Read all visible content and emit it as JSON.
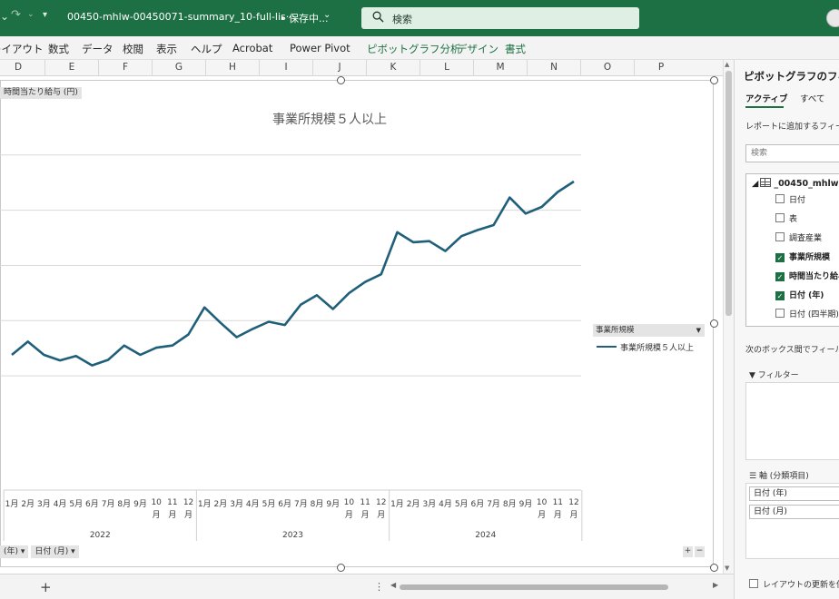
{
  "titlebar": {
    "filename": "00450-mhlw-00450071-summary_10-full-lis···",
    "save_status": "• 保存中...",
    "search_label": "検索",
    "qat_glyph": "▾",
    "chevron_glyph": "⌄"
  },
  "ribbon": {
    "tabs": [
      {
        "label": "レイアウト"
      },
      {
        "label": "数式"
      },
      {
        "label": "データ"
      },
      {
        "label": "校閲"
      },
      {
        "label": "表示"
      },
      {
        "label": "ヘルプ"
      },
      {
        "label": "Acrobat"
      },
      {
        "label": "Power Pivot"
      },
      {
        "label": "ピボットグラフ分析"
      },
      {
        "label": "デザイン"
      },
      {
        "label": "書式"
      }
    ],
    "accent_color": "#1d7044"
  },
  "columns": [
    "D",
    "E",
    "F",
    "G",
    "H",
    "I",
    "J",
    "K",
    "L",
    "M",
    "N",
    "O",
    "P"
  ],
  "chart": {
    "value_field_button": "時間当たり給与 (円)",
    "legend_field_button": "事業所規模",
    "axis_field_buttons": [
      "(年) ▾",
      "日付 (月) ▾"
    ],
    "zoom_in": "+",
    "zoom_out": "−"
  },
  "chart_data": {
    "type": "line",
    "title": "事業所規模５人以上",
    "years": [
      "2022",
      "2023",
      "2024"
    ],
    "month_labels": [
      "1月",
      "2月",
      "3月",
      "4月",
      "5月",
      "6月",
      "7月",
      "8月",
      "9月",
      "10月",
      "11月",
      "12月"
    ],
    "series": [
      {
        "name": "事業所規模５人以上",
        "color": "#1f5f7a",
        "values": [
          38,
          62,
          38,
          28,
          36,
          19,
          29,
          55,
          38,
          51,
          55,
          75,
          124,
          96,
          70,
          85,
          98,
          92,
          129,
          146,
          121,
          150,
          170,
          184,
          260,
          242,
          244,
          226,
          253,
          264,
          273,
          323,
          294,
          306,
          333,
          352
        ]
      }
    ],
    "ylim": [
      -82,
      421
    ],
    "grid": true,
    "legend_position": "right",
    "axis_ticks_shown": false
  },
  "panel": {
    "title": "ピボットグラフのフィールド",
    "tabs": [
      "アクティブ",
      "すべて"
    ],
    "hint": "レポートに追加するフィールドを選択してください:",
    "search_placeholder": "検索",
    "table_name": "_00450_mhlw",
    "fields": [
      {
        "label": "日付",
        "checked": false,
        "bold": false
      },
      {
        "label": "表",
        "checked": false,
        "bold": false
      },
      {
        "label": "調査産業",
        "checked": false,
        "bold": false
      },
      {
        "label": "事業所規模",
        "checked": true,
        "bold": true
      },
      {
        "label": "時間当たり給与 (円)",
        "checked": true,
        "bold": true
      },
      {
        "label": "日付 (年)",
        "checked": true,
        "bold": true
      },
      {
        "label": "日付 (四半期)",
        "checked": false,
        "bold": false
      },
      {
        "label": "日付 (月)",
        "checked": true,
        "bold": true
      }
    ],
    "drag_note": "次のボックス間でフィールドをドラッグしてください:",
    "filter_label": "フィルター",
    "axis_label": "軸 (分類項目)",
    "axis_items": [
      "日付 (年)",
      "日付 (月)"
    ],
    "defer_label": "レイアウトの更新を保留する"
  },
  "sheetbar": {
    "add_label": "+",
    "more_label": "⋮"
  }
}
